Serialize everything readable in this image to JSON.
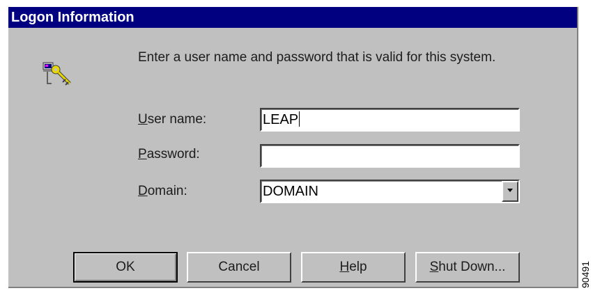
{
  "window": {
    "title": "Logon Information"
  },
  "icon": "key-logon-icon",
  "intro_text": "Enter a user name and password that is valid for this system.",
  "form": {
    "username": {
      "label_accel": "U",
      "label_rest": "ser name:",
      "value": "LEAP"
    },
    "password": {
      "label_accel": "P",
      "label_rest": "assword:",
      "value": ""
    },
    "domain": {
      "label_accel": "D",
      "label_rest": "omain:",
      "value": "DOMAIN"
    }
  },
  "buttons": {
    "ok": "OK",
    "cancel": "Cancel",
    "help_accel": "H",
    "help_rest": "elp",
    "shutdown_accel": "S",
    "shutdown_rest": "hut Down..."
  },
  "figure_id": "90491",
  "colors": {
    "titlebar": "#000080",
    "dialog_bg": "#c0c0c0"
  }
}
